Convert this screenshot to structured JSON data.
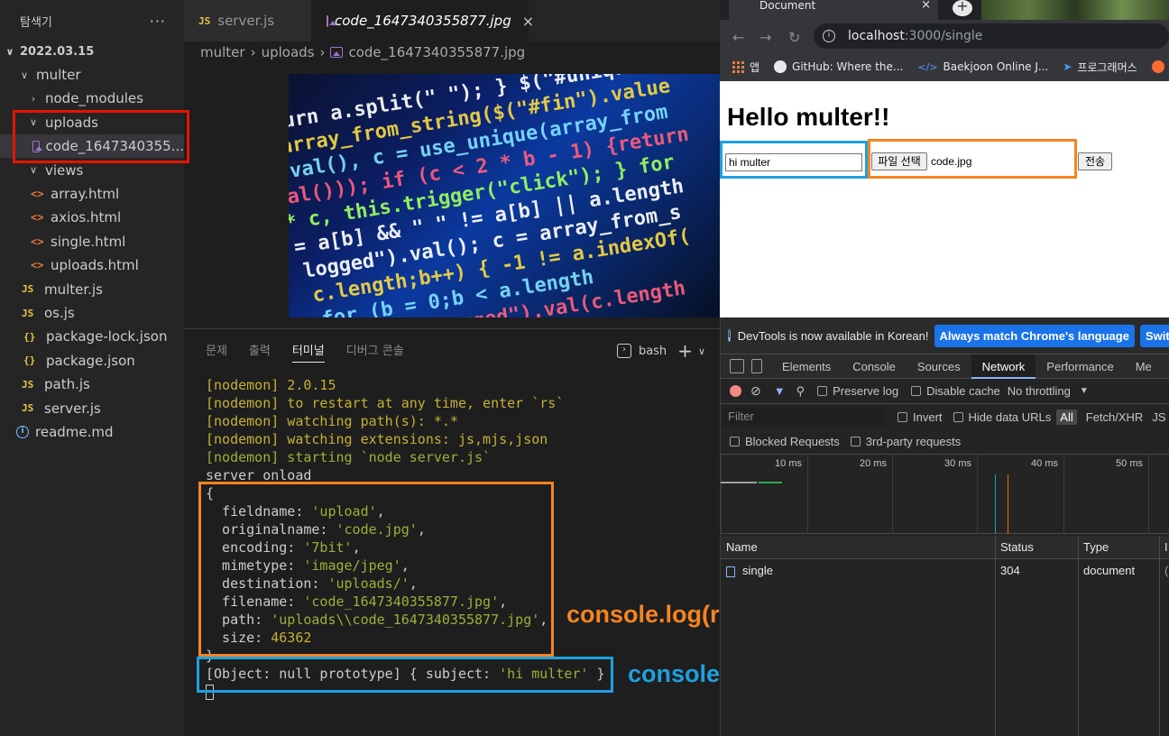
{
  "vscode": {
    "explorer_title": "탐색기",
    "more_label": "···",
    "root_folder": "2022.03.15",
    "tree": [
      {
        "label": "multer",
        "type": "folder-open",
        "depth": 1
      },
      {
        "label": "node_modules",
        "type": "folder-closed",
        "depth": 2
      },
      {
        "label": "uploads",
        "type": "folder-open",
        "depth": 2
      },
      {
        "label": "code_1647340355...",
        "type": "image",
        "depth": 3,
        "selected": true
      },
      {
        "label": "views",
        "type": "folder-open",
        "depth": 2
      },
      {
        "label": "array.html",
        "type": "html",
        "depth": 3
      },
      {
        "label": "axios.html",
        "type": "html",
        "depth": 3
      },
      {
        "label": "single.html",
        "type": "html",
        "depth": 3
      },
      {
        "label": "uploads.html",
        "type": "html",
        "depth": 3
      },
      {
        "label": "multer.js",
        "type": "js",
        "depth": 2
      },
      {
        "label": "os.js",
        "type": "js",
        "depth": 2
      },
      {
        "label": "package-lock.json",
        "type": "json",
        "depth": 2
      },
      {
        "label": "package.json",
        "type": "json",
        "depth": 2
      },
      {
        "label": "path.js",
        "type": "js",
        "depth": 2
      },
      {
        "label": "server.js",
        "type": "js",
        "depth": 2
      },
      {
        "label": "readme.md",
        "type": "info",
        "depth": 1
      }
    ],
    "tabs": [
      {
        "icon": "JS",
        "label": "server.js"
      },
      {
        "label": "code_1647340355877.jpg",
        "close": "×"
      }
    ],
    "breadcrumb": [
      "multer",
      "uploads",
      "code_1647340355877.jpg"
    ],
    "code_preview_lines": [
      "return a.split(\" \"); } $(\"#unique\")",
      "= array_from_string($(\"#fin\").value",
      ").val(), c = use_unique(array_from",
      "val())); if (c < 2 * b - 1) {return",
      "* c, this.trigger(\"click\"); } for",
      "= a[b] && \" \" != a[b] || a.length",
      "logged\").val(); c = array_from_s",
      "c.length;b++) { -1 != a.indexOf(",
      "for (b = 0;b < a.length",
      "$(\"#User_logged\").val(c.length"
    ],
    "panel_tabs": [
      "문제",
      "출력",
      "터미널",
      "디버그 콘솔"
    ],
    "shell": "bash",
    "add_terminal": "+",
    "terminal_lines": [
      {
        "text": "[nodemon] 2.0.15",
        "color": "#c5b136"
      },
      {
        "text": "[nodemon] to restart at any time, enter `rs`",
        "color": "#c5b136"
      },
      {
        "text": "[nodemon] watching path(s): *.*",
        "color": "#c5b136"
      },
      {
        "text": "[nodemon] watching extensions: js,mjs,json",
        "color": "#c5b136"
      },
      {
        "text": "[nodemon] starting `node server.js`",
        "color": "#9cb03a"
      },
      {
        "text": "server onload",
        "color": "#cccccc"
      },
      {
        "text": "{",
        "color": "#cccccc"
      }
    ],
    "file_object": [
      {
        "key": "fieldname",
        "value": "'upload'"
      },
      {
        "key": "originalname",
        "value": "'code.jpg'"
      },
      {
        "key": "encoding",
        "value": "'7bit'"
      },
      {
        "key": "mimetype",
        "value": "'image/jpeg'"
      },
      {
        "key": "destination",
        "value": "'uploads/'"
      },
      {
        "key": "filename",
        "value": "'code_1647340355877.jpg'"
      },
      {
        "key": "path",
        "value": "'uploads\\\\code_1647340355877.jpg'"
      },
      {
        "key": "size",
        "value": "46362"
      }
    ],
    "closing_brace": "}",
    "body_line_prefix": "[Object: null prototype] { subject: ",
    "body_line_value": "'hi multer'",
    "body_line_suffix": " }",
    "annotation_file": "console.log(req.file)",
    "annotation_body": "console.log(req.body)"
  },
  "browser": {
    "tab_title": "Document",
    "tab_close": "×",
    "new_tab": "+",
    "url_host": "localhost",
    "url_path": ":3000/single",
    "bookmarks": [
      "앱",
      "GitHub: Where the...",
      "Baekjoon Online J...",
      "프로그래머스"
    ],
    "page_heading": "Hello multer!!",
    "text_input_value": "hi multer",
    "file_button": "파일 선택",
    "file_name": "code.jpg",
    "submit_button": "전송"
  },
  "devtools": {
    "banner_text": "DevTools is now available in Korean!",
    "banner_button1": "Always match Chrome's language",
    "banner_button2": "Switch",
    "tabs": [
      "Elements",
      "Console",
      "Sources",
      "Network",
      "Performance",
      "Me"
    ],
    "active_tab": "Network",
    "preserve_log": "Preserve log",
    "disable_cache": "Disable cache",
    "throttling": "No throttling",
    "filter_placeholder": "Filter",
    "invert": "Invert",
    "hide_data_urls": "Hide data URLs",
    "all": "All",
    "fetch_xhr": "Fetch/XHR",
    "js": "JS",
    "blocked_requests": "Blocked Requests",
    "third_party": "3rd-party requests",
    "timeline_ticks": [
      "10 ms",
      "20 ms",
      "30 ms",
      "40 ms",
      "50 ms"
    ],
    "columns": [
      "Name",
      "Status",
      "Type",
      "I"
    ],
    "rows": [
      {
        "name": "single",
        "status": "304",
        "type": "document",
        "extra": "("
      }
    ]
  }
}
